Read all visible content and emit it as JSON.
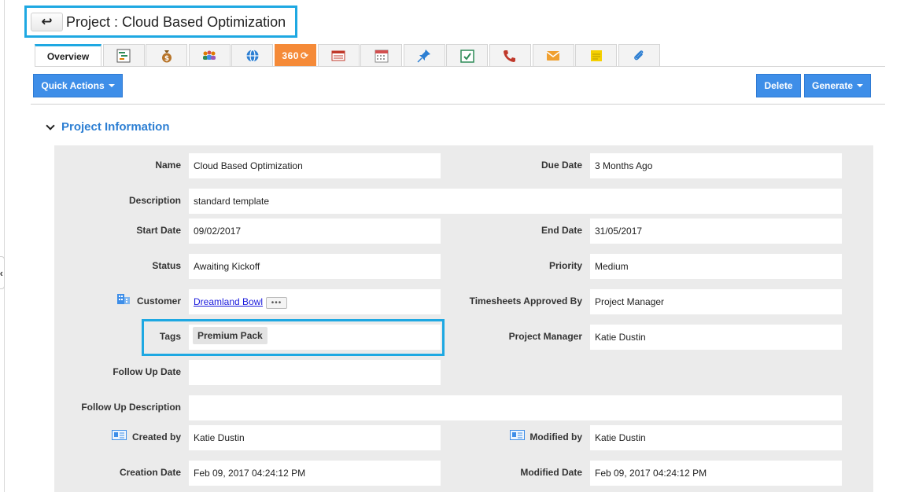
{
  "header": {
    "back_label": "↩",
    "title": "Project : Cloud Based Optimization"
  },
  "tabs": {
    "overview_label": "Overview",
    "t360_label": "360",
    "icons": [
      "gantt-chart-icon",
      "money-bag-icon",
      "users-icon",
      "globe-icon",
      "360-icon",
      "invoice-icon",
      "calendar-icon",
      "pin-icon",
      "task-check-icon",
      "phone-icon",
      "mail-icon",
      "notes-icon",
      "attachment-icon"
    ]
  },
  "actions": {
    "quick_actions_label": "Quick Actions",
    "delete_label": "Delete",
    "generate_label": "Generate"
  },
  "section": {
    "title": "Project Information"
  },
  "fields": {
    "name": {
      "label": "Name",
      "value": "Cloud Based Optimization"
    },
    "due_date": {
      "label": "Due Date",
      "value": "3 Months Ago"
    },
    "description": {
      "label": "Description",
      "value": "standard template"
    },
    "start_date": {
      "label": "Start Date",
      "value": "09/02/2017"
    },
    "end_date": {
      "label": "End Date",
      "value": "31/05/2017"
    },
    "status": {
      "label": "Status",
      "value": "Awaiting Kickoff"
    },
    "priority": {
      "label": "Priority",
      "value": "Medium"
    },
    "customer": {
      "label": "Customer",
      "value": "Dreamland Bowl",
      "more": "•••"
    },
    "timesheets": {
      "label": "Timesheets Approved By",
      "value": "Project Manager"
    },
    "tags": {
      "label": "Tags",
      "value": "Premium Pack"
    },
    "project_manager": {
      "label": "Project Manager",
      "value": "Katie Dustin"
    },
    "follow_up_date": {
      "label": "Follow Up Date",
      "value": ""
    },
    "follow_up_description": {
      "label": "Follow Up Description",
      "value": ""
    },
    "created_by": {
      "label": "Created by",
      "value": "Katie Dustin"
    },
    "modified_by": {
      "label": "Modified by",
      "value": "Katie Dustin"
    },
    "creation_date": {
      "label": "Creation Date",
      "value": "Feb 09, 2017 04:24:12 PM"
    },
    "modified_date": {
      "label": "Modified Date",
      "value": "Feb 09, 2017 04:24:12 PM"
    }
  },
  "colors": {
    "accent": "#1ea8e2",
    "button_blue": "#3e8ee8",
    "section_title": "#2d7fd3",
    "tab_360": "#f58a38",
    "panel_bg": "#ebebeb"
  }
}
